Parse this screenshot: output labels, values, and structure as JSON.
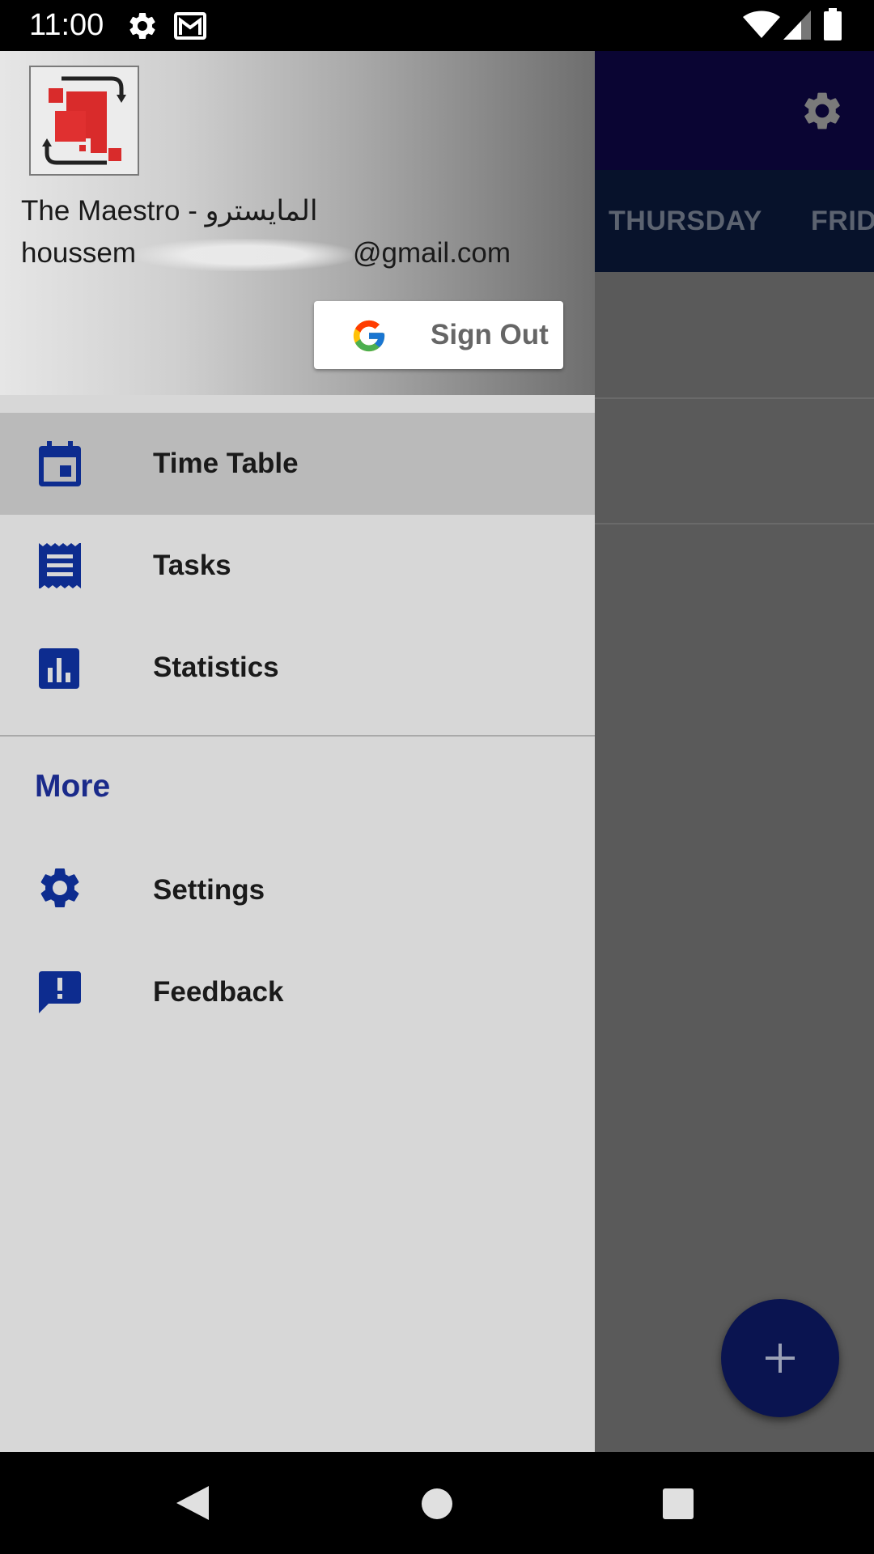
{
  "status_bar": {
    "time": "11:00",
    "icons": [
      "settings-icon",
      "gmail-icon",
      "wifi-icon",
      "signal-icon",
      "battery-icon"
    ]
  },
  "background_app": {
    "toolbar": {
      "icon": "settings-icon",
      "color": "#0a0533"
    },
    "tabs": [
      "THURSDAY",
      "FRID"
    ],
    "fab": {
      "icon": "plus-icon",
      "color": "#0a1450"
    }
  },
  "drawer": {
    "header": {
      "logo": "app-logo",
      "user_name": "The Maestro - المايسترو",
      "email_prefix": "houssem",
      "email_suffix": "@gmail.com",
      "sign_out_label": "Sign Out"
    },
    "items": [
      {
        "label": "Time Table",
        "icon": "calendar-icon",
        "selected": true
      },
      {
        "label": "Tasks",
        "icon": "receipt-icon",
        "selected": false
      },
      {
        "label": "Statistics",
        "icon": "bar-chart-icon",
        "selected": false
      }
    ],
    "more_section": {
      "title": "More",
      "items": [
        {
          "label": "Settings",
          "icon": "settings-icon"
        },
        {
          "label": "Feedback",
          "icon": "feedback-icon"
        }
      ]
    },
    "accent_color": "#0d2c8f"
  },
  "nav_bar": {
    "buttons": [
      "back",
      "home",
      "recents"
    ]
  }
}
